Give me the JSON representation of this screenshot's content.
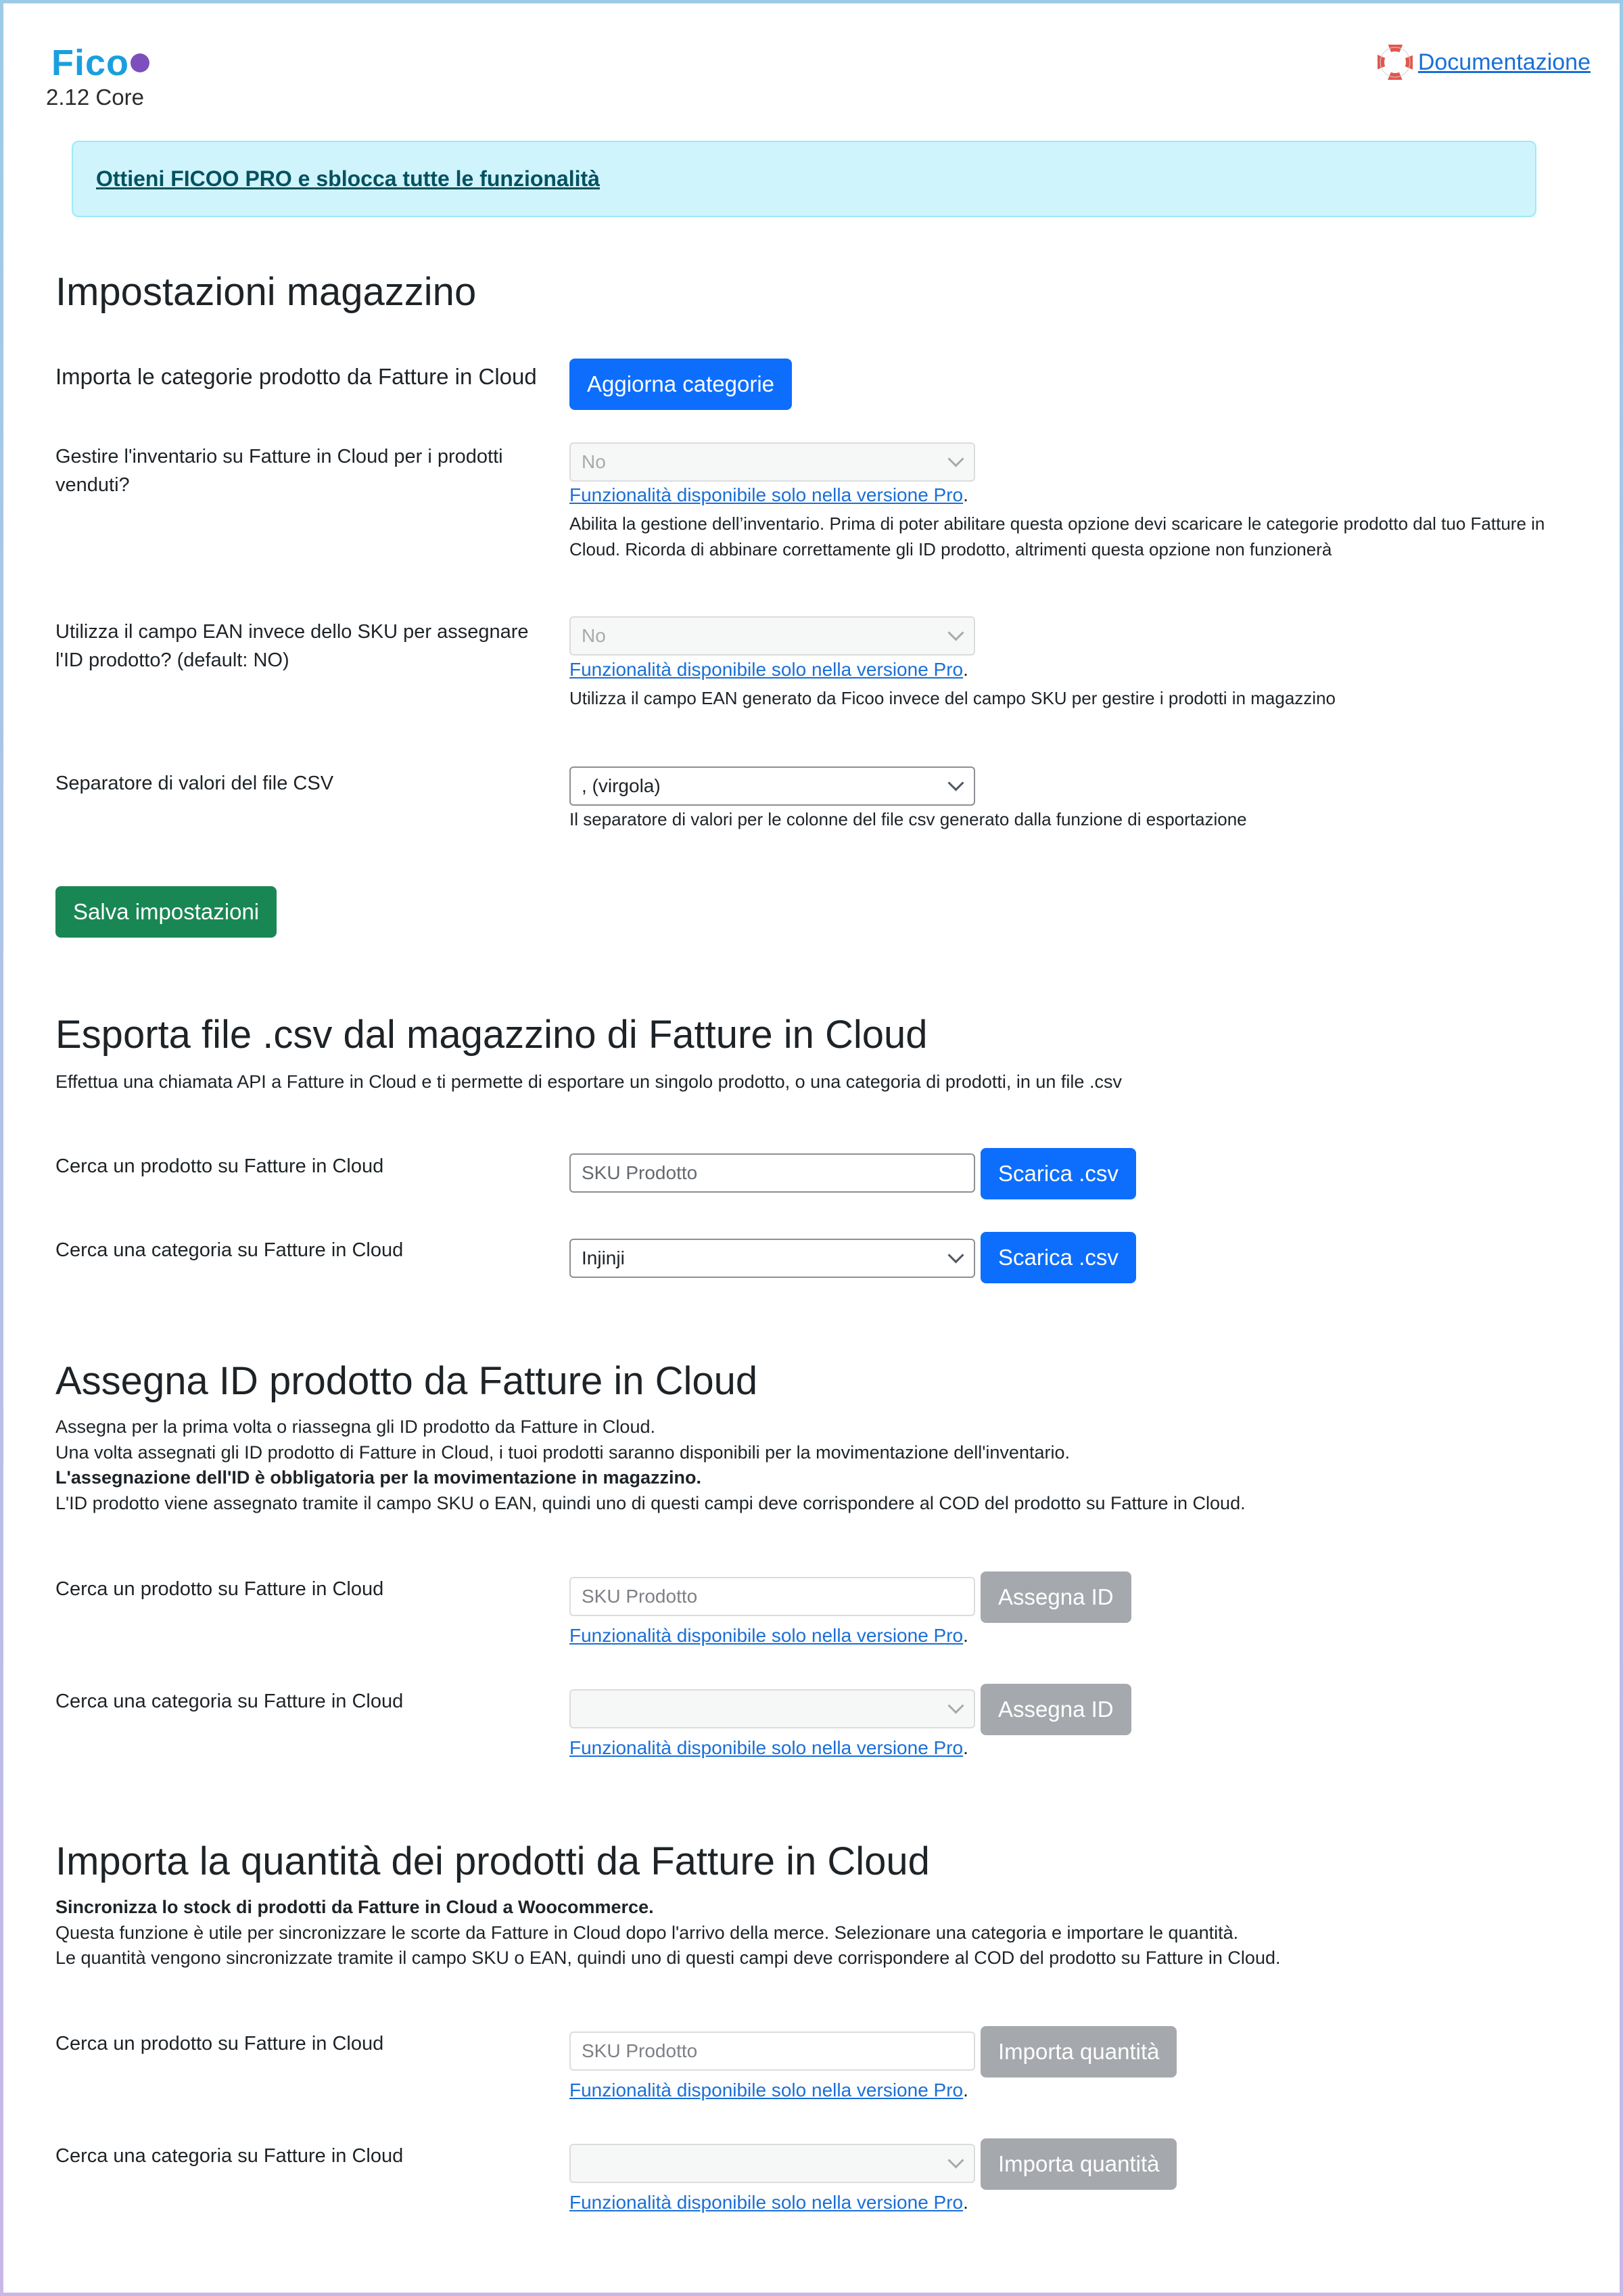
{
  "header": {
    "logo_text": "Fico",
    "version": "2.12 Core",
    "docs_link": "Documentazione",
    "docs_icon": "lifebuoy-icon"
  },
  "banner": {
    "text": "Ottieni FICOO PRO e sblocca tutte le funzionalità"
  },
  "pro_notice": "Funzionalità disponibile solo nella versione Pro",
  "warehouse": {
    "title": "Impostazioni magazzino",
    "import_categories_label": "Importa le categorie prodotto da Fatture in Cloud",
    "import_categories_button": "Aggiorna categorie",
    "inventory_label": "Gestire l'inventario su Fatture in Cloud per i prodotti venduti?",
    "inventory_value": "No",
    "inventory_help": "Abilita la gestione dell’inventario. Prima di poter abilitare questa opzione devi scaricare le categorie prodotto dal tuo Fatture in Cloud. Ricorda di abbinare correttamente gli ID prodotto, altrimenti questa opzione non funzionerà",
    "ean_label": "Utilizza il campo EAN invece dello SKU per assegnare l'ID prodotto? (default: NO)",
    "ean_value": "No",
    "ean_help": "Utilizza il campo EAN generato da Ficoo invece del campo SKU per gestire i prodotti in magazzino",
    "csv_sep_label": "Separatore di valori del file CSV",
    "csv_sep_value": ", (virgola)",
    "csv_sep_help": "Il separatore di valori per le colonne del file csv generato dalla funzione di esportazione",
    "save_button": "Salva impostazioni"
  },
  "export": {
    "title": "Esporta file .csv dal magazzino di Fatture in Cloud",
    "desc": "Effettua una chiamata API a Fatture in Cloud e ti permette di esportare un singolo prodotto, o una categoria di prodotti, in un file .csv",
    "product_label": "Cerca un prodotto su Fatture in Cloud",
    "product_placeholder": "SKU Prodotto",
    "product_button": "Scarica .csv",
    "category_label": "Cerca una categoria su Fatture in Cloud",
    "category_value": "Injinji",
    "category_button": "Scarica .csv"
  },
  "assign": {
    "title": "Assegna ID prodotto da Fatture in Cloud",
    "desc1": "Assegna per la prima volta o riassegna gli ID prodotto da Fatture in Cloud.",
    "desc2": "Una volta assegnati gli ID prodotto di Fatture in Cloud, i tuoi prodotti saranno disponibili per la movimentazione dell'inventario.",
    "desc3": "L'assegnazione dell'ID è obbligatoria per la movimentazione in magazzino.",
    "desc4": "L'ID prodotto viene assegnato tramite il campo SKU o EAN, quindi uno di questi campi deve corrispondere al COD del prodotto su Fatture in Cloud.",
    "product_label": "Cerca un prodotto su Fatture in Cloud",
    "product_placeholder": "SKU Prodotto",
    "product_button": "Assegna ID",
    "category_label": "Cerca una categoria su Fatture in Cloud",
    "category_value": "",
    "category_button": "Assegna ID"
  },
  "quantity": {
    "title": "Importa la quantità dei prodotti da Fatture in Cloud",
    "desc1": "Sincronizza lo stock di prodotti da Fatture in Cloud a Woocommerce.",
    "desc2": "Questa funzione è utile per sincronizzare le scorte da Fatture in Cloud dopo l'arrivo della merce. Selezionare una categoria e importare le quantità.",
    "desc3": "Le quantità vengono sincronizzate tramite il campo SKU o EAN, quindi uno di questi campi deve corrispondere al COD del prodotto su Fatture in Cloud.",
    "product_label": "Cerca un prodotto su Fatture in Cloud",
    "product_placeholder": "SKU Prodotto",
    "product_button": "Importa quantità",
    "category_label": "Cerca una categoria su Fatture in Cloud",
    "category_value": "",
    "category_button": "Importa quantità"
  },
  "colors": {
    "primary": "#0d6efd",
    "success": "#198754",
    "disabled": "#a5a8ad",
    "banner_bg": "#cff4fc",
    "link": "#1a6fd6"
  }
}
